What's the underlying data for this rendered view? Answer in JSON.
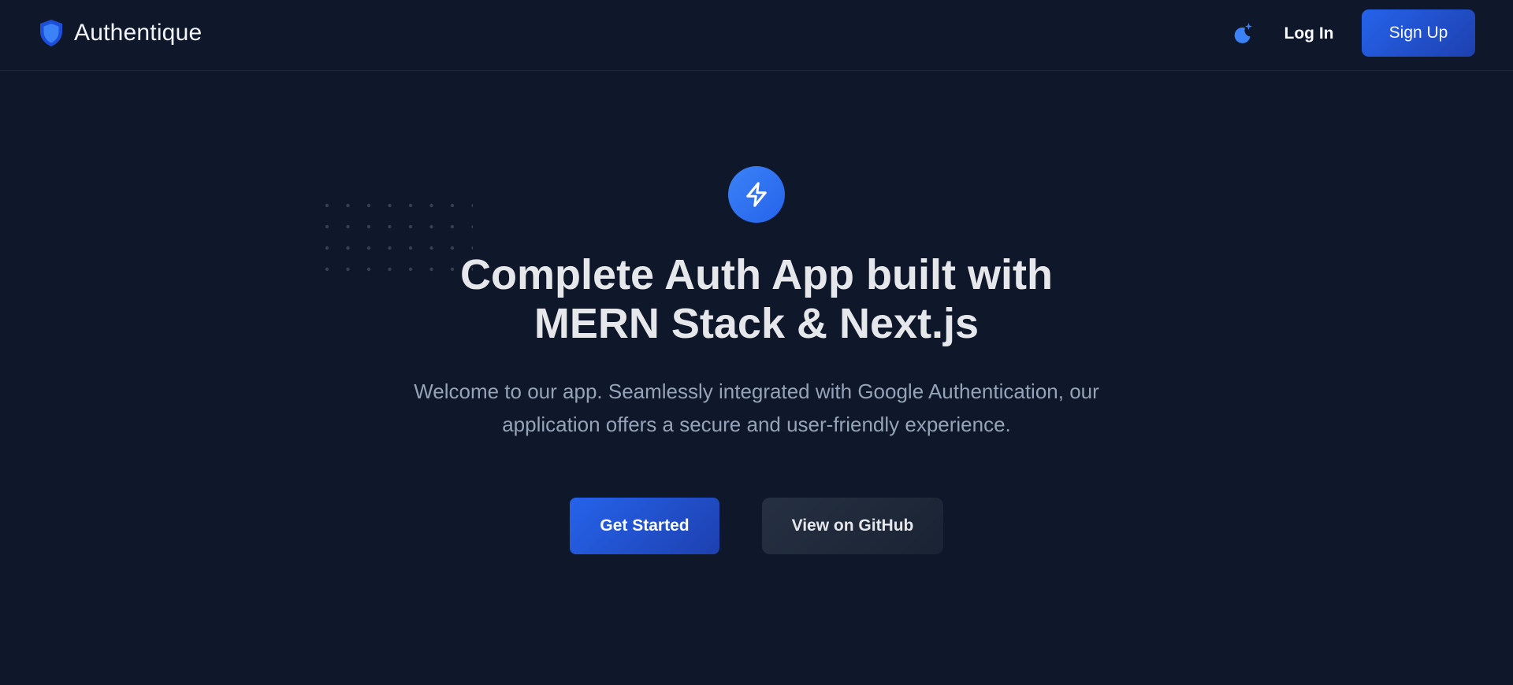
{
  "header": {
    "brand_name": "Authentique",
    "brand_icon": "shield-icon",
    "theme_toggle_icon": "moon-star-icon",
    "login_label": "Log In",
    "signup_label": "Sign Up"
  },
  "hero": {
    "icon": "lightning-bolt-icon",
    "title_lines": [
      "Complete Auth App built with",
      "MERN Stack & Next.js"
    ],
    "subtitle_lines": [
      "Welcome to our app. Seamlessly integrated with Google Authentication, our",
      "application offers a secure and user-friendly experience."
    ],
    "primary_button_label": "Get Started",
    "secondary_button_label": "View on GitHub"
  },
  "colors": {
    "background": "#0f172a",
    "accent": "#2563eb",
    "text_primary": "#e5e7eb",
    "text_muted": "#94a3b8"
  }
}
